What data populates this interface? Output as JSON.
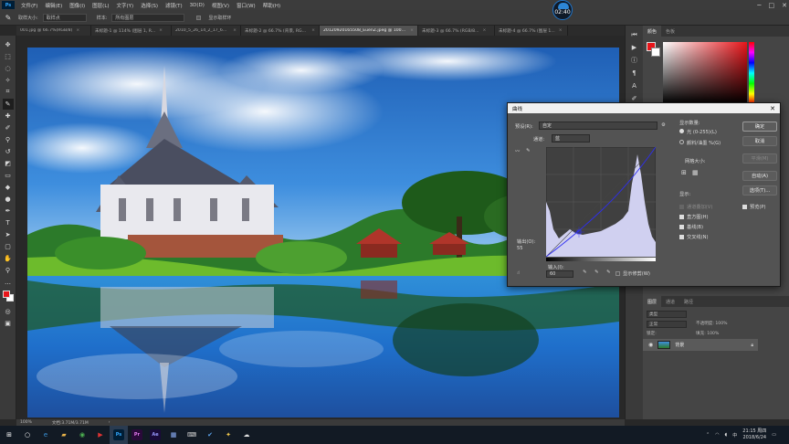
{
  "menu": [
    "文件(F)",
    "编辑(E)",
    "图像(I)",
    "图层(L)",
    "文字(Y)",
    "选择(S)",
    "滤镜(T)",
    "3D(D)",
    "视图(V)",
    "窗口(W)",
    "帮助(H)"
  ],
  "app_badge": "Ps",
  "options_bar": {
    "sample_size_label": "取样大小:",
    "sample_size_value": "取样点",
    "sample_label": "样本:",
    "sample_value": "所有图层",
    "show_ring_label": "显示取样环"
  },
  "timer": "02:40",
  "tabs": [
    {
      "label": "001.jpg @ 66.7%(RGB/8)",
      "active": false
    },
    {
      "label": "未标题-1 @ 114% (图层 1, R...",
      "active": false
    },
    {
      "label": "2010_5_26_14_2_17_6834.jpg...",
      "active": false
    },
    {
      "label": "未标题-2 @ 66.7% (背景, RGB...",
      "active": false
    },
    {
      "label": "20120920165508_EuenZ.jpeg @ 100%(RGB/8#)",
      "active": true
    },
    {
      "label": "未标题-3 @ 66.7% (RGB/8...",
      "active": false
    },
    {
      "label": "未标题-4 @ 66.7% (图层 1...",
      "active": false
    }
  ],
  "status_bar": {
    "zoom": "100%",
    "doc_info": "文档:3.71M/3.71M"
  },
  "curves": {
    "title": "曲线",
    "preset_label": "预设(R):",
    "preset_value": "自定",
    "channel_label": "通道:",
    "channel_value": "蓝",
    "output_label": "输出(O):",
    "output_value": "55",
    "input_label": "输入(I):",
    "input_value": "60",
    "show_clipping": "显示修剪(W)",
    "display_amount_label": "显示数量:",
    "opt_light": "光 (0-255)(L)",
    "opt_pigment": "颜料/油墨 %(G)",
    "grid_size_label": "网格大小:",
    "show_label": "显示:",
    "show_items": [
      {
        "label": "通道叠加(V)",
        "checked": false
      },
      {
        "label": "直方图(H)",
        "checked": true
      },
      {
        "label": "基线(B)",
        "checked": true
      },
      {
        "label": "交叉线(N)",
        "checked": true
      }
    ],
    "ok": "确定",
    "cancel": "取消",
    "smooth": "平滑(M)",
    "auto": "自动(A)",
    "options": "选项(T)...",
    "preview": "预览(P)"
  },
  "panels": {
    "top_tabs": [
      "颜色",
      "色板"
    ],
    "bottom_tabs": [
      "图层",
      "通道",
      "路径"
    ],
    "layers_kind": "类型",
    "layers_blend": "正常",
    "layers_opacity": "不透明度: 100%",
    "layers_lock": "锁定:",
    "layers_fill": "填充: 100%",
    "layer_name": "背景"
  },
  "taskbar": {
    "time": "21:15 周四",
    "date": "2018/6/24",
    "lang": "中"
  },
  "colors": {
    "accent": "#1f74c8",
    "foreground": "#e8151a",
    "background": "#ffffff"
  }
}
